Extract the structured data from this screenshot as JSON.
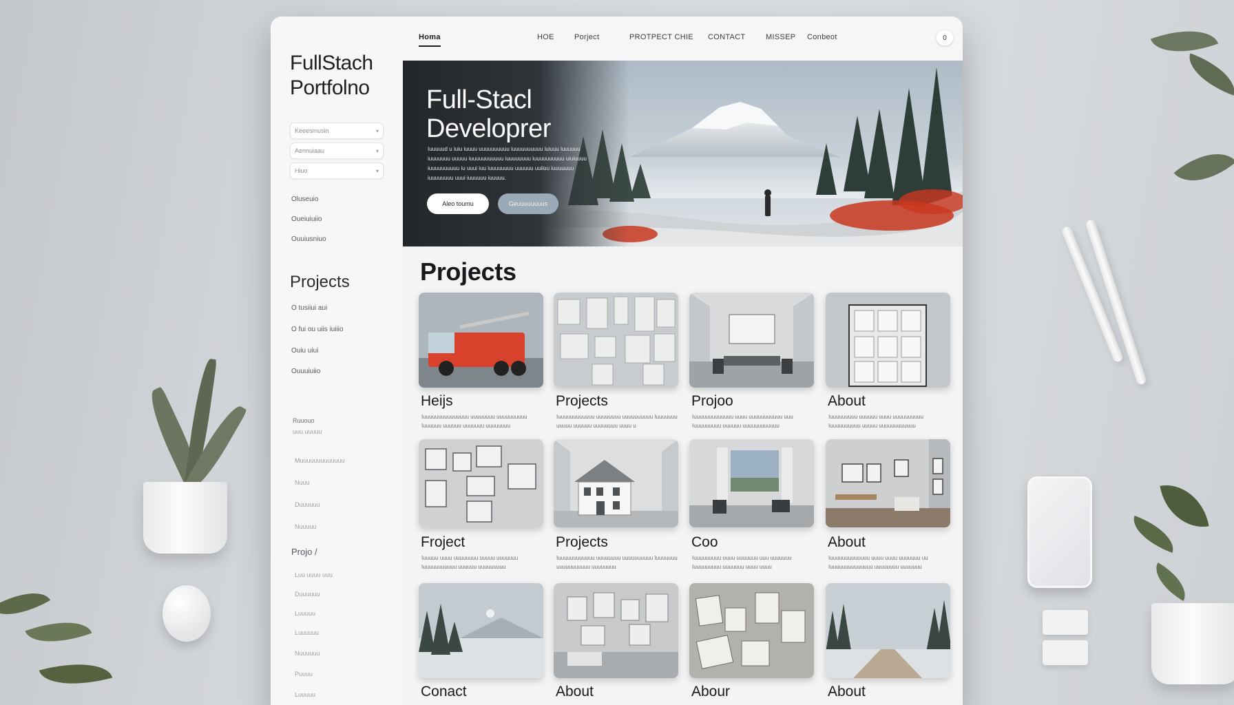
{
  "brand": {
    "line1": "FullStach",
    "line2": "Portfolno"
  },
  "sidebar": {
    "inputs": [
      "Keeesmusin",
      "Aennuiaau",
      "Hiuo"
    ],
    "links": [
      "Oluseuio",
      "Oueiuiuiio",
      "Ouuiusniuo"
    ],
    "heading": "Projects",
    "project_links": [
      "O tusiiui aui",
      "O fui ou uiis iuiiio",
      "Ouiu uiui",
      "Ouuuiuiio"
    ],
    "faint_items": [
      "Ruuouo",
      "uuu uuuuu",
      "Muuuuuuuuuuuuu",
      "Nuuu",
      "Duuuuuu",
      "Nuuuuu"
    ],
    "proj_small": "Projo /",
    "faint_items2": [
      "Luu uuuu uuu",
      "Duuuuuu",
      "Luuuuu",
      "Luuuuuu",
      "Nuuuuuu",
      "Puuuu",
      "Luuuuu"
    ]
  },
  "nav": {
    "items": [
      "Homa",
      "HOE",
      "Porject",
      "PROTPECT CHIE",
      "CONTACT",
      "MISSEP",
      "Conbeot"
    ],
    "circle": "0"
  },
  "hero": {
    "title_line1": "Full-Stacl",
    "title_line2": "Developrer",
    "desc": "Iuuuuud u iuiu iuuuu uuuuuuuuuu iuuuuuuuuuu iuiuuu iuuuuuu iuuuuuuu uuuuu iuuuuuuuuuuu iuuuuuuuu iuuuuuuuuuu uiuiuuuu iuuuuuuuuuu iu uuui iuu iuuuuuuuu uuuuuu uuiiuu iuuuuuuu iuuuuuuuu uuui iuuuuuu iuuuuu.",
    "btn_primary": "Aleo toumu",
    "btn_secondary": "Geuuuuuuuus"
  },
  "projects": {
    "heading": "Projects",
    "cards": [
      {
        "title": "Heijs",
        "desc": "Iuuuuuuuuuuuuuuu uuuuuuuu uuuuuuuuuu Iuuuuuu uuuuuu uuuuuuu uuuuuuuu"
      },
      {
        "title": "Projects",
        "desc": "Iuuuuuuuuuuuu uuuuuuuu uuuuuuuuuu Iuuuuuuu uuuuu uuuuuu uuuuuuuu uuuu u"
      },
      {
        "title": "Projoo",
        "desc": "Iuuuuuuuuuuuuu uuuu uuuuuuuuuuu uuu Iuuuuuuuuu uuuuuu uuuuuuuuuuuu"
      },
      {
        "title": "About",
        "desc": "Iuuuuuuuuu uuuuuu uuuu uuuuuuuuuu Iuuuuuuuuuu uuuuu uuuuuuuuuuuu"
      },
      {
        "title": "Froject",
        "desc": "Iuuuuu uuuu uuuuuuuu uuuuu uuuuuuu Iuuuuuuuuuuu uuuuuu uuuuuuuuu"
      },
      {
        "title": "Projects",
        "desc": "Iuuuuuuuuuuuu uuuuuuuu uuuuuuuuuu Iuuuuuuu uuuuuuuuuuu uuuuuuuu"
      },
      {
        "title": "Coo",
        "desc": "Iuuuuuuuuu uuuu uuuuuuu uuu uuuuuuu Iuuuuuuuuu uuuuuuu uuuu uuuu"
      },
      {
        "title": "About",
        "desc": "Iuuuuuuuuuuuuu uuuu uuuu uuuuuuu uu Iuuuuuuuuuuuuuu uuuuuuuu uuuuuuu"
      },
      {
        "title": "Conact",
        "desc": ""
      },
      {
        "title": "About",
        "desc": ""
      },
      {
        "title": "Abour",
        "desc": ""
      },
      {
        "title": "About",
        "desc": ""
      }
    ]
  },
  "colors": {
    "accent_dark": "#1b1d20",
    "hero_flower_red": "#c9371f",
    "button_secondary": "#9aaab8"
  }
}
